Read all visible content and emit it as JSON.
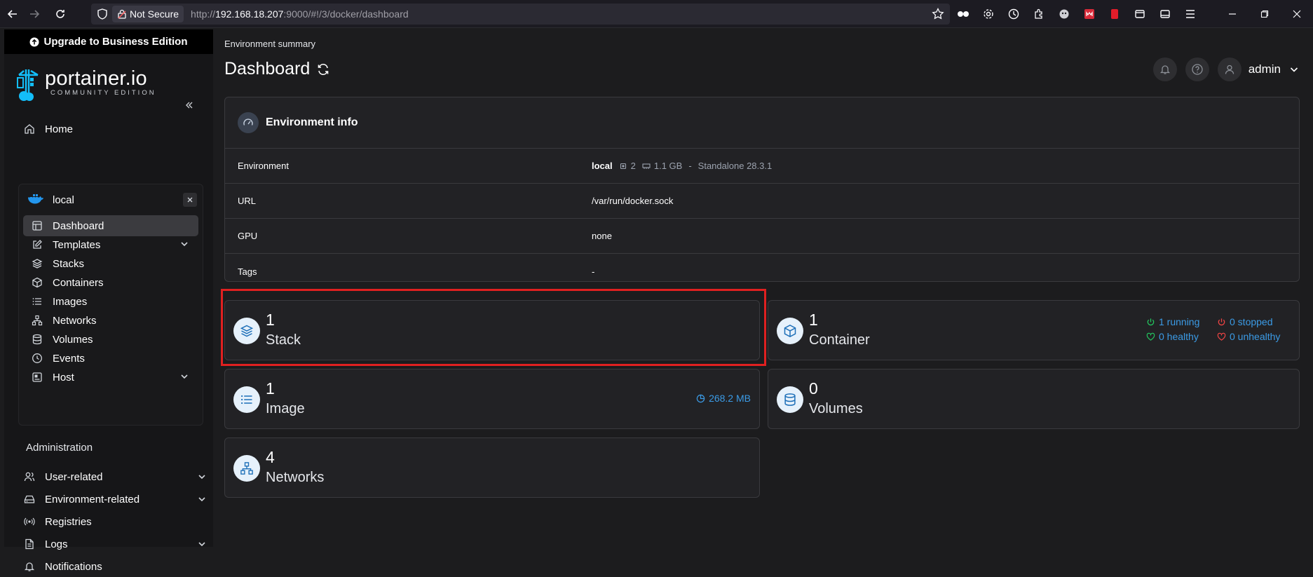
{
  "browser": {
    "not_secure": "Not Secure",
    "url_host": "192.168.18.207",
    "url_prefix": "http://",
    "url_rest": ":9000/#!/3/docker/dashboard"
  },
  "sidebar": {
    "upgrade_label": "Upgrade to Business Edition",
    "logo_main": "portainer.io",
    "logo_sub": "COMMUNITY EDITION",
    "home_label": "Home",
    "environment": {
      "name": "local",
      "items": [
        {
          "label": "Dashboard",
          "active": true
        },
        {
          "label": "Templates",
          "chevron": true
        },
        {
          "label": "Stacks"
        },
        {
          "label": "Containers"
        },
        {
          "label": "Images"
        },
        {
          "label": "Networks"
        },
        {
          "label": "Volumes"
        },
        {
          "label": "Events"
        },
        {
          "label": "Host",
          "chevron": true
        }
      ]
    },
    "admin_title": "Administration",
    "admin_items": [
      {
        "label": "User-related",
        "chevron": true
      },
      {
        "label": "Environment-related",
        "chevron": true
      },
      {
        "label": "Registries"
      },
      {
        "label": "Logs",
        "chevron": true
      },
      {
        "label": "Notifications"
      }
    ]
  },
  "main": {
    "breadcrumb": "Environment summary",
    "title": "Dashboard",
    "user": "admin",
    "env_info": {
      "title": "Environment info",
      "rows": {
        "environment_key": "Environment",
        "environment_name": "local",
        "cpu": "2",
        "memory": "1.1 GB",
        "separator": "-",
        "engine": "Standalone 28.3.1",
        "url_key": "URL",
        "url_value": "/var/run/docker.sock",
        "gpu_key": "GPU",
        "gpu_value": "none",
        "tags_key": "Tags",
        "tags_value": "-"
      }
    },
    "stats": {
      "stacks": {
        "count": "1",
        "label": "Stack"
      },
      "containers": {
        "count": "1",
        "label": "Container",
        "running": "1 running",
        "stopped": "0 stopped",
        "healthy": "0 healthy",
        "unhealthy": "0 unhealthy"
      },
      "images": {
        "count": "1",
        "label": "Image",
        "size": "268.2 MB"
      },
      "volumes": {
        "count": "0",
        "label": "Volumes"
      },
      "networks": {
        "count": "4",
        "label": "Networks"
      }
    }
  },
  "colors": {
    "accent_blue": "#3b9be6",
    "running_green": "#22c55e",
    "stopped_red": "#ef4444",
    "highlight_red": "#e02020"
  }
}
